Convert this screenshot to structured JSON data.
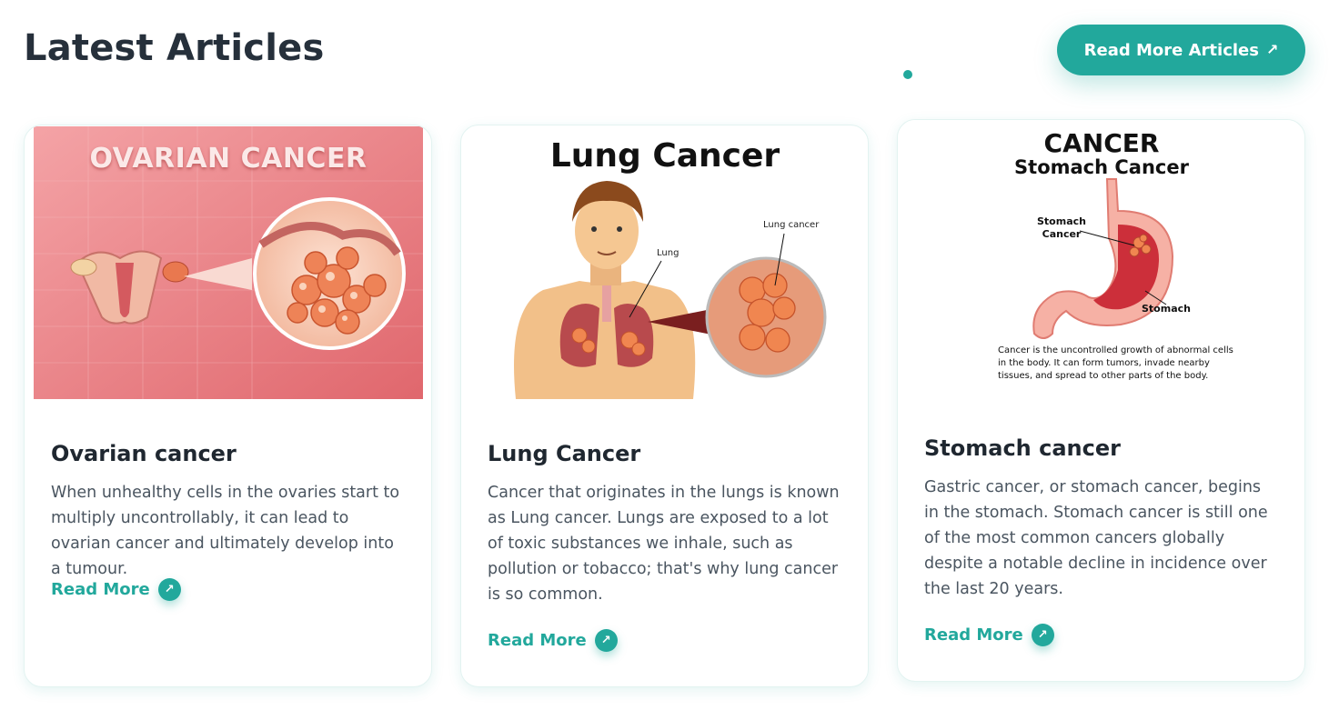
{
  "header": {
    "title": "Latest Articles",
    "cta_label": "Read More Articles",
    "cta_icon": "arrow-up-right-icon"
  },
  "colors": {
    "accent": "#22a89c",
    "title": "#26303b",
    "text": "#4a5560"
  },
  "articles": [
    {
      "title": "Ovarian cancer",
      "description": "When unhealthy cells in the ovaries start to multiply uncontrollably, it can lead to ovarian cancer and ultimately develop into a tumour.",
      "read_more": "Read More",
      "image_label": "OVARIAN CANCER"
    },
    {
      "title": "Lung Cancer",
      "description": "Cancer that originates in the lungs is known as Lung cancer. Lungs are exposed to a lot of toxic substances we inhale, such as pollution or tobacco; that's why lung cancer is so common.",
      "read_more": "Read More",
      "image_label": "Lung Cancer",
      "image_callout_lung": "Lung",
      "image_callout_cancer": "Lung cancer"
    },
    {
      "title": "Stomach cancer",
      "description": "Gastric cancer, or stomach cancer, begins in the stomach. Stomach cancer is still one of the most common cancers globally despite a notable decline in incidence over the last 20 years.",
      "read_more": "Read More",
      "image_label": "CANCER",
      "image_sublabel": "Stomach Cancer",
      "image_callout_cancer": "Stomach Cancer",
      "image_callout_organ": "Stomach",
      "image_caption": "Cancer is the uncontrolled growth of abnormal cells in the body. It can form tumors, invade nearby tissues, and spread to other parts of the body."
    }
  ]
}
